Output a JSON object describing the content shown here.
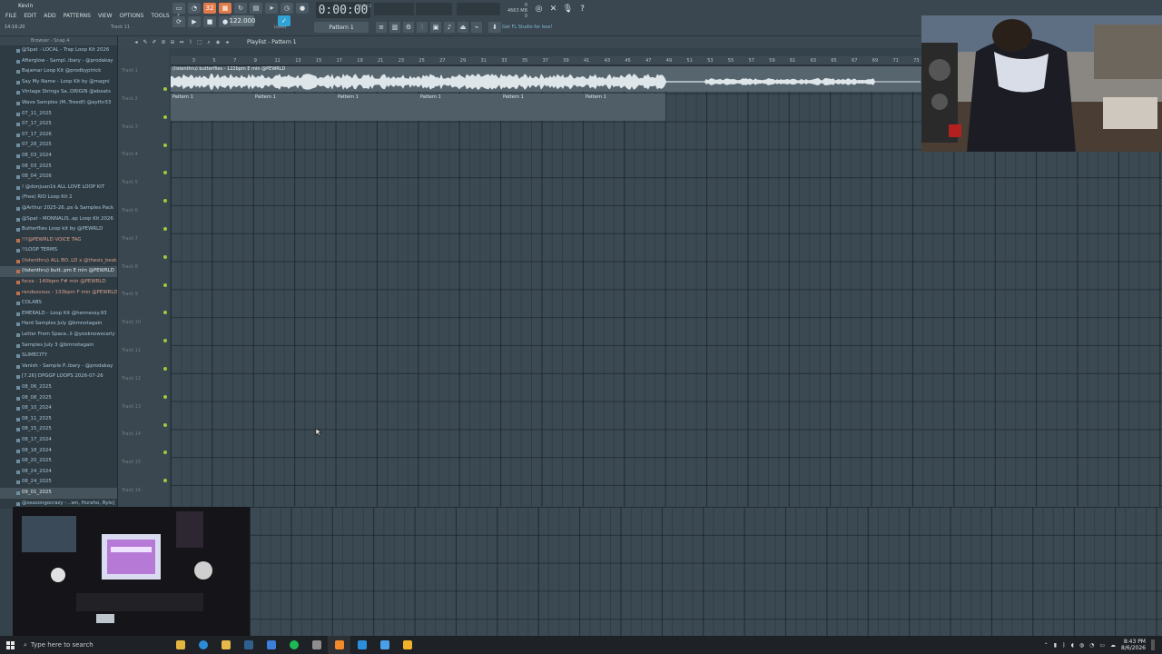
{
  "window": {
    "title": "Kevin",
    "menu": [
      "FILE",
      "EDIT",
      "ADD",
      "PATTERNS",
      "VIEW",
      "OPTIONS",
      "TOOLS",
      "?"
    ],
    "small_clock": "14:16:20",
    "small_track": "Track 11"
  },
  "transport": {
    "tempo": "122.000",
    "time": "0:00:00",
    "time_sub": "M:S:CS",
    "pattern": "Pattern 1",
    "memory_line1": "0",
    "memory_line2": "4663 MB",
    "memory_line3": "0",
    "mixer_label": "(none)",
    "news": "Get FL Studio for less!"
  },
  "browser": {
    "header": "Browser - Snap 4",
    "items": [
      {
        "label": "@Spat - LOCAL - Trap Loop Kit 2026",
        "type": "folder"
      },
      {
        "label": "Afterglow - Sampl..ibary - @prodakay",
        "type": "folder"
      },
      {
        "label": "Bajamar Loop Kit @prodbyptrick",
        "type": "folder"
      },
      {
        "label": "Say My Name - Loop Kit by @magni",
        "type": "folder"
      },
      {
        "label": "Vintage Strings Sa..ORIGIN @ebeats",
        "type": "folder"
      },
      {
        "label": "Wave Samples (M..Treedf) @aythr33",
        "type": "folder"
      },
      {
        "label": "07_11_2025",
        "type": "folder"
      },
      {
        "label": "07_17_2025",
        "type": "folder"
      },
      {
        "label": "07_17_2026",
        "type": "folder"
      },
      {
        "label": "07_28_2025",
        "type": "folder"
      },
      {
        "label": "08_03_2024",
        "type": "folder"
      },
      {
        "label": "08_03_2025",
        "type": "folder"
      },
      {
        "label": "08_04_2026",
        "type": "folder"
      },
      {
        "label": "! @donjuan1k ALL LOVE LOOP KIT",
        "type": "folder"
      },
      {
        "label": "(Free) RIO Loop Kit 2",
        "type": "folder"
      },
      {
        "label": "@Arthur 2025-26..ps & Samples Pack",
        "type": "folder"
      },
      {
        "label": "@Spat - MONNALIS..ap Loop Kit 2026",
        "type": "folder"
      },
      {
        "label": "Butterflies Loop kit by @PEWRLD",
        "type": "folder"
      },
      {
        "label": "!!!@PEWRLD VOICE TAG",
        "type": "audio"
      },
      {
        "label": "!!LOOP TERMS",
        "type": "file"
      },
      {
        "label": "(listenthru) ALL BO..LD x @thesis_beatz",
        "type": "audio"
      },
      {
        "label": "(listenthru) butt..pm E min @PEWRLD",
        "type": "audio",
        "selected": true
      },
      {
        "label": "forza - 140bpm F# min @PEWRLD",
        "type": "audio"
      },
      {
        "label": "rendezvous - 133bpm F min @PEWRLD",
        "type": "audio"
      },
      {
        "label": "COLABS",
        "type": "folder"
      },
      {
        "label": "EMERALD - Loop Kit @hennessy.93",
        "type": "folder"
      },
      {
        "label": "Hard Samples July @bmnotagain",
        "type": "folder"
      },
      {
        "label": "Letter From Space..il @yooknowscarly",
        "type": "folder"
      },
      {
        "label": "Samples July 3 @bmnotagain",
        "type": "folder"
      },
      {
        "label": "SLIMECITY",
        "type": "folder"
      },
      {
        "label": "Vanish - Sample P..ibary - @prodakay",
        "type": "folder"
      },
      {
        "label": "[7.26] DPGGP LOOPS 2026-07-26",
        "type": "folder"
      },
      {
        "label": "08_06_2025",
        "type": "folder"
      },
      {
        "label": "08_08_2025",
        "type": "folder"
      },
      {
        "label": "08_10_2024",
        "type": "folder"
      },
      {
        "label": "08_11_2025",
        "type": "folder"
      },
      {
        "label": "08_15_2025",
        "type": "folder"
      },
      {
        "label": "08_17_2024",
        "type": "folder"
      },
      {
        "label": "08_18_2024",
        "type": "folder"
      },
      {
        "label": "08_20_2025",
        "type": "folder"
      },
      {
        "label": "08_24_2024",
        "type": "folder"
      },
      {
        "label": "08_24_2025",
        "type": "folder"
      },
      {
        "label": "09_01_2025",
        "type": "folder",
        "selected": true
      },
      {
        "label": "@seasongocrazy - ..wn, Huraho, Rylo]",
        "type": "folder"
      }
    ]
  },
  "playlist": {
    "title": "Playlist - Pattern 1",
    "ruler": [
      "3",
      "5",
      "7",
      "9",
      "11",
      "13",
      "15",
      "17",
      "19",
      "21",
      "23",
      "25",
      "27",
      "29",
      "31",
      "33",
      "35",
      "37",
      "39",
      "41",
      "43",
      "45",
      "47",
      "49",
      "51",
      "53",
      "55",
      "57",
      "59",
      "61",
      "63",
      "65",
      "67",
      "69",
      "71",
      "73"
    ],
    "tracks": [
      "Track 1",
      "Track 2",
      "Track 3",
      "Track 4",
      "Track 5",
      "Track 6",
      "Track 7",
      "Track 8",
      "Track 9",
      "Track 10",
      "Track 11",
      "Track 12",
      "Track 13",
      "Track 14",
      "Track 15",
      "Track 16"
    ],
    "audio_clip": "(listenthru) butterflies - 122bpm E min @PEWRLD",
    "pattern_clips": [
      "Pattern 1",
      "Pattern 1",
      "Pattern 1",
      "Pattern 1",
      "Pattern 1",
      "Pattern 1"
    ]
  },
  "taskbar": {
    "search_placeholder": "Type here to search",
    "time": "8:43 PM",
    "date": "8/6/2026"
  }
}
